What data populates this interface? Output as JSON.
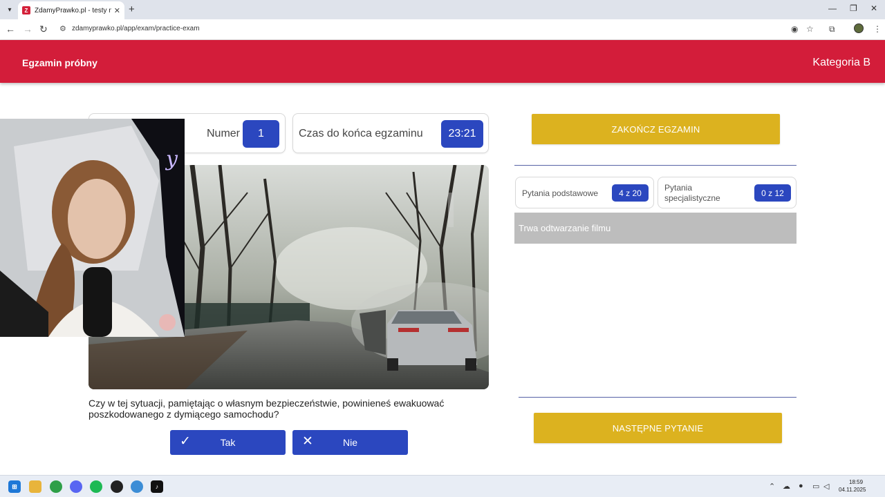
{
  "browser": {
    "tab_title": "ZdamyPrawko.pl - testy na prawo jazdy",
    "favicon_letter": "Z",
    "url": "zdamyprawko.pl/app/exam/practice-exam"
  },
  "header": {
    "title": "Egzamin próbny",
    "category": "Kategoria B"
  },
  "question_counter": {
    "label": "Numer pytania",
    "value": "1"
  },
  "timer": {
    "label": "Czas do końca egzaminu",
    "value": "23:21"
  },
  "question": {
    "text": "Czy w tej sytuacji, pamiętając o własnym bezpieczeństwie, powinieneś ewakuować poszkodowanego z dymiącego samochodu?"
  },
  "answers": {
    "yes_label": "Tak",
    "no_label": "Nie"
  },
  "sidebar": {
    "end_exam_label": "ZAKOŃCZ EGZAMIN",
    "basic_label": "Pytania podstawowe",
    "basic_value": "4 z 20",
    "specialist_label_line1": "Pytania",
    "specialist_label_line2": "specjalistyczne",
    "specialist_value": "0 z 12",
    "status": "Trwa odtwarzanie filmu",
    "next_label": "NASTĘPNE PYTANIE"
  },
  "taskbar": {
    "time": "18:59",
    "date": "04.11.2025"
  },
  "colors": {
    "brand_red": "#d31d3a",
    "accent_blue": "#2b47bf",
    "gold": "#dcb21f",
    "status_gray": "#bdbdbd"
  }
}
